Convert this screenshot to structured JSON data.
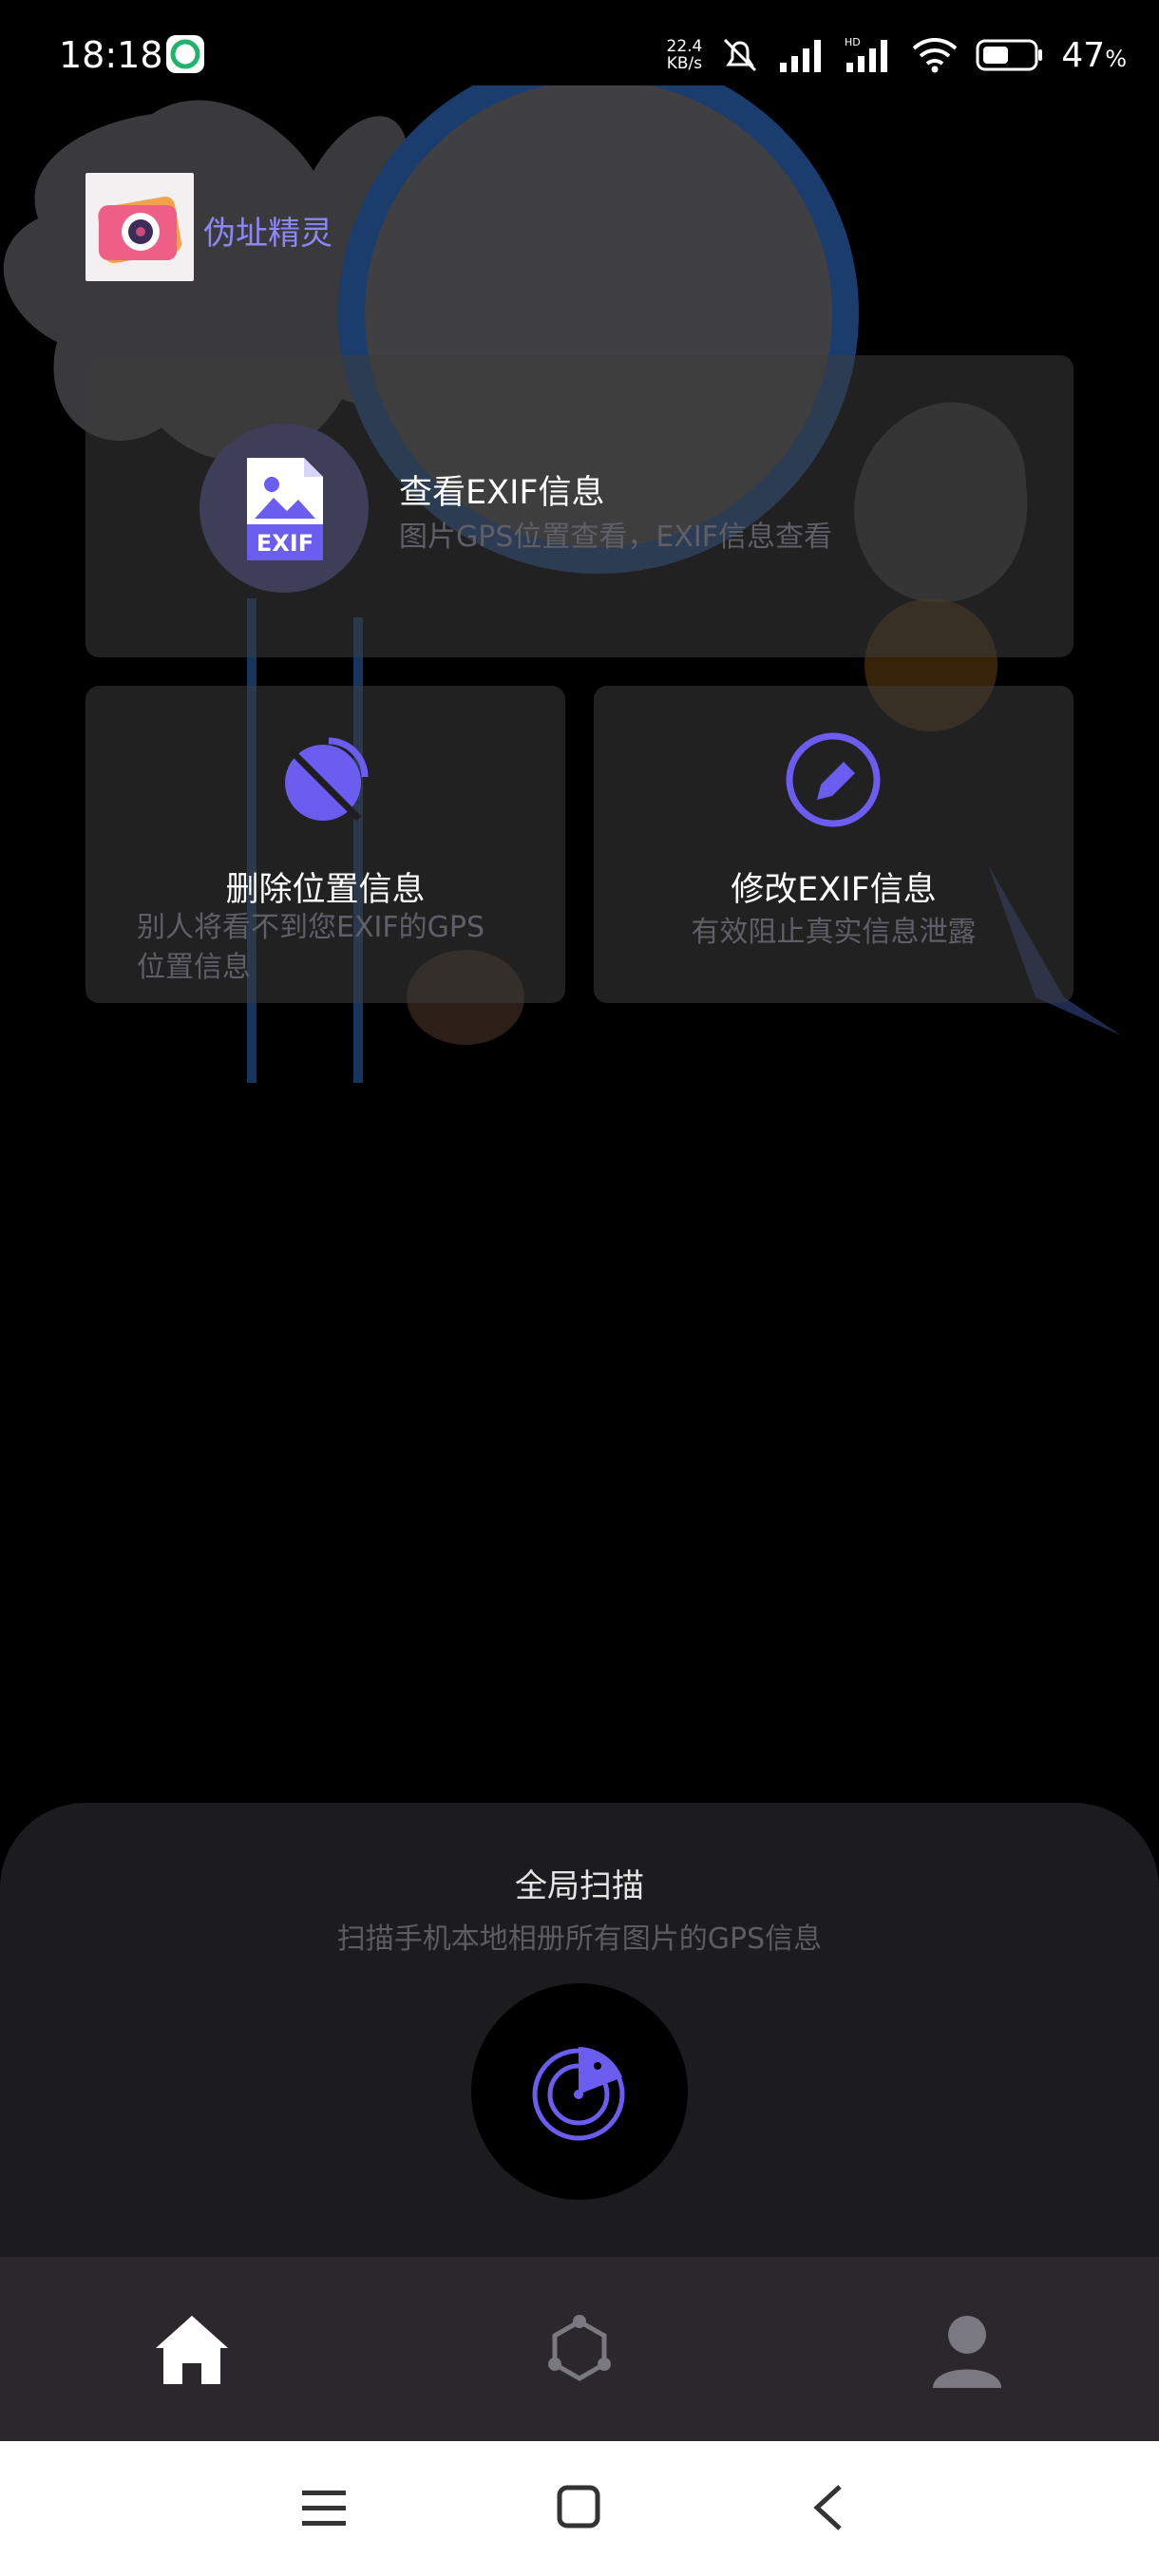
{
  "status_bar": {
    "time": "18:18",
    "net_speed_value": "22.4",
    "net_speed_unit": "KB/s",
    "battery_percent": "47",
    "battery_unit": "%"
  },
  "header": {
    "app_name": "伪址精灵"
  },
  "cards": {
    "view_exif": {
      "title": "查看EXIF信息",
      "subtitle": "图片GPS位置查看，EXIF信息查看",
      "icon_label": "EXIF"
    },
    "remove_location": {
      "title": "删除位置信息",
      "subtitle": "别人将看不到您EXIF的GPS位置信息"
    },
    "modify_exif": {
      "title": "修改EXIF信息",
      "subtitle": "有效阻止真实信息泄露"
    }
  },
  "scan": {
    "title": "全局扫描",
    "subtitle": "扫描手机本地相册所有图片的GPS信息"
  },
  "bottom_nav": [
    "home-icon",
    "hub-icon",
    "profile-icon"
  ],
  "colors": {
    "accent": "#6b5df0",
    "app_name": "#8c87f5",
    "card_bg": "#3c3c3c",
    "panel_bg": "#1c1c1e",
    "nav_bg": "#2a282d"
  }
}
